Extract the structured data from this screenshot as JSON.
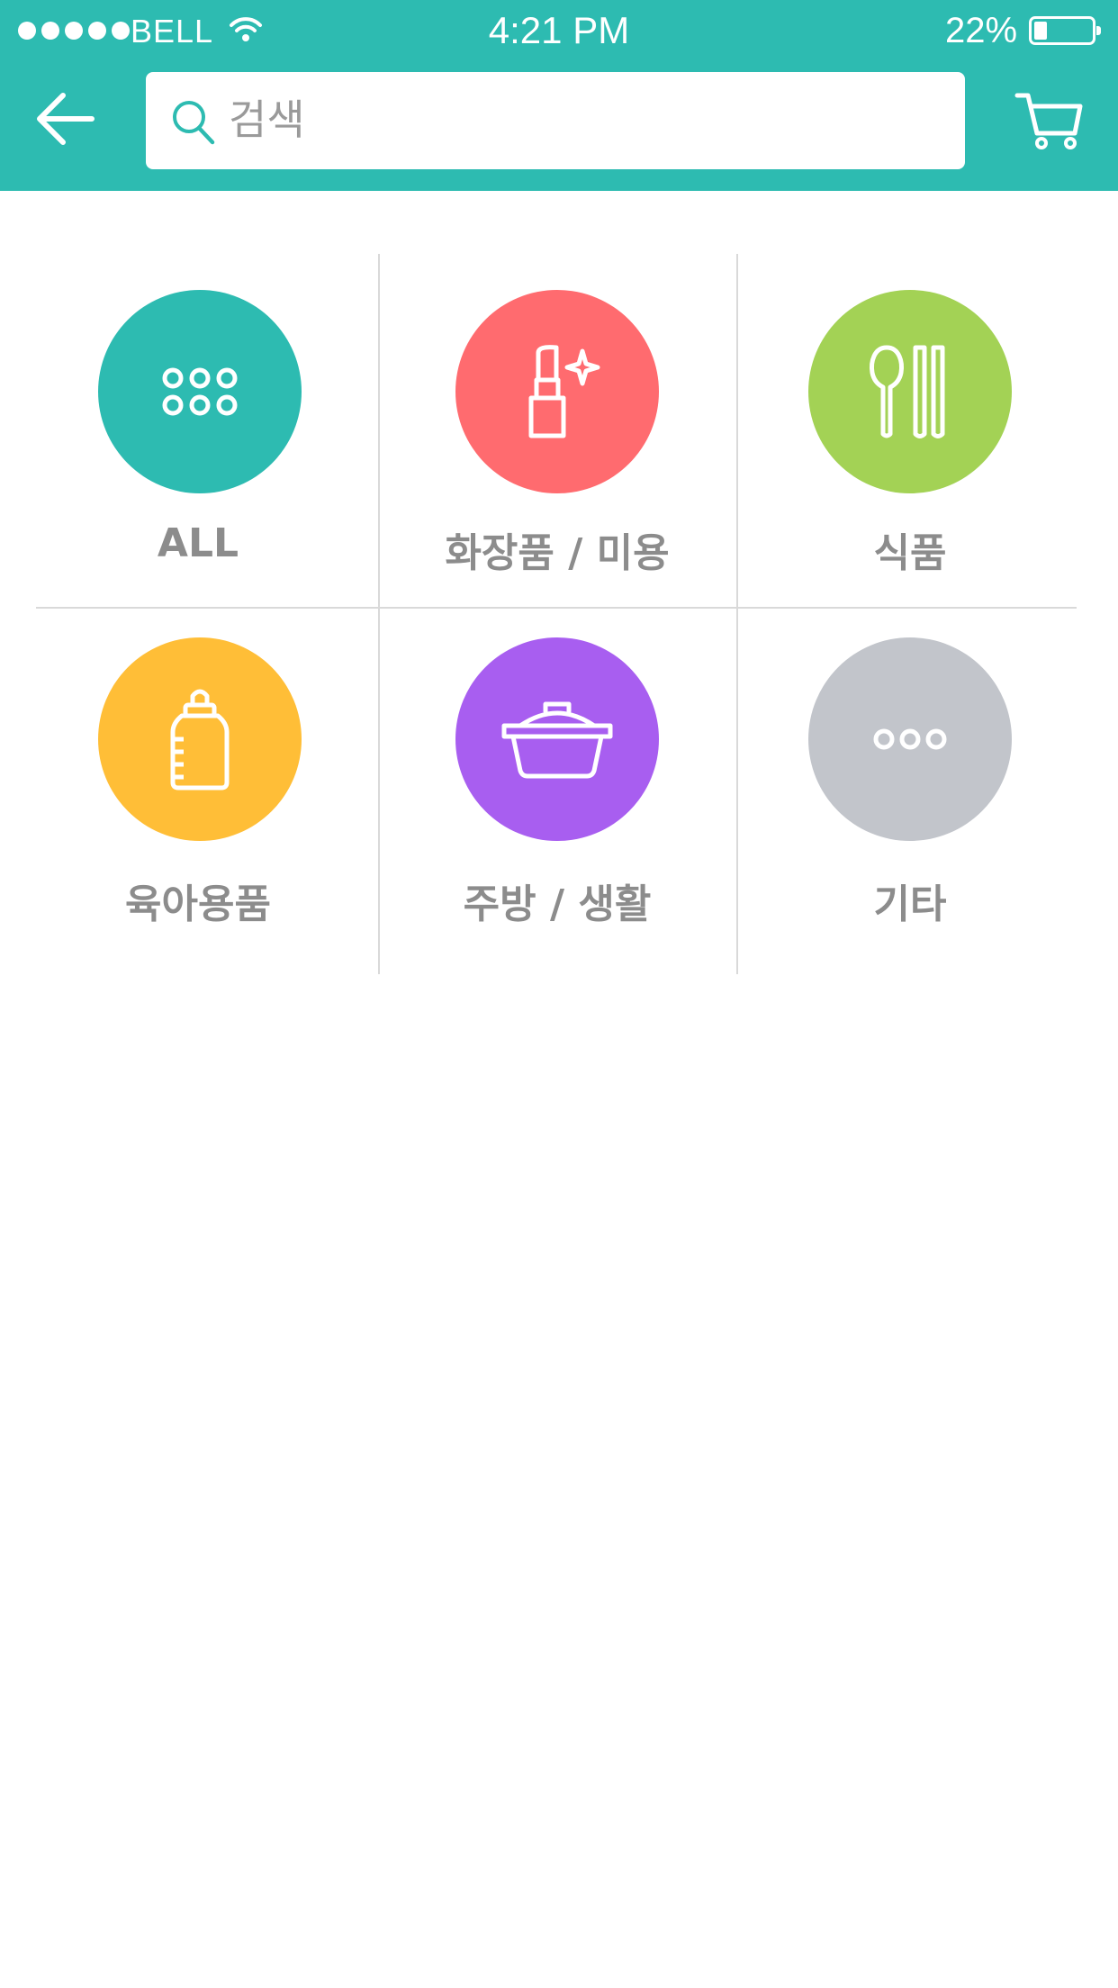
{
  "status_bar": {
    "carrier": "BELL",
    "time": "4:21 PM",
    "battery_percent": "22%",
    "signal_bars": 5,
    "battery_level": 0.22
  },
  "header": {
    "back_icon": "arrow-left-icon",
    "search": {
      "placeholder": "검색",
      "value": "",
      "icon": "search-icon"
    },
    "cart_icon": "cart-icon"
  },
  "colors": {
    "header_bg": "#2dbbb1",
    "all": "#2dbbb1",
    "beauty": "#ff6b6f",
    "food": "#a3d255",
    "baby": "#ffbe37",
    "kitchen": "#a85ef0",
    "etc": "#c2c5cb",
    "label": "#8c8c8c"
  },
  "categories": [
    {
      "label": "ALL",
      "icon": "grid-dots-icon"
    },
    {
      "label": "화장품 / 미용",
      "icon": "lipstick-icon"
    },
    {
      "label": "식품",
      "icon": "spoon-chopsticks-icon"
    },
    {
      "label": "육아용품",
      "icon": "baby-bottle-icon"
    },
    {
      "label": "주방 / 생활",
      "icon": "pot-icon"
    },
    {
      "label": "기타",
      "icon": "more-dots-icon"
    }
  ]
}
